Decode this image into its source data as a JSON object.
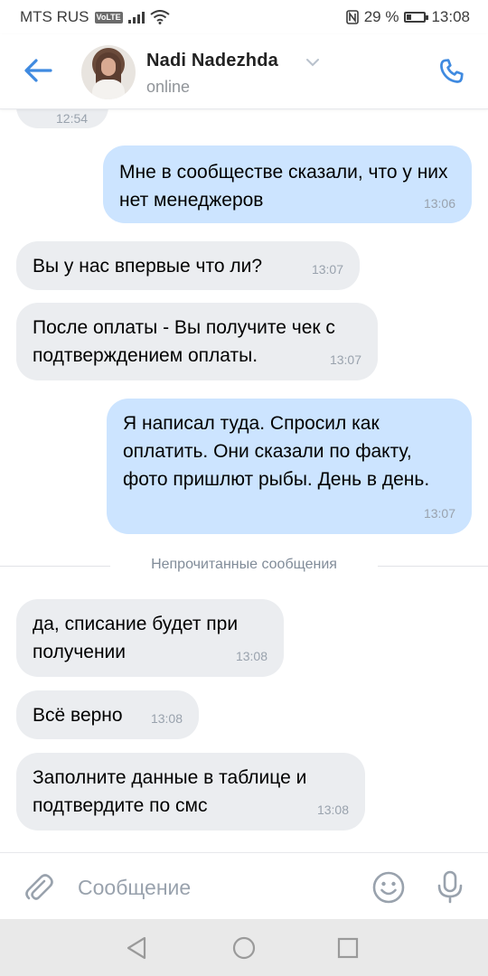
{
  "status_bar": {
    "carrier": "MTS RUS",
    "volte": "VoLTE",
    "battery": "29 %",
    "battery_level": 0.29,
    "time": "13:08"
  },
  "header": {
    "name": "Nadi Nadezhda",
    "status": "online",
    "icons": {
      "back": "back-arrow-icon",
      "call": "phone-icon",
      "dropdown": "chevron-down-icon"
    },
    "accent_color": "#3f8ae0"
  },
  "messages": [
    {
      "dir": "in",
      "text": "",
      "time": "12:54"
    },
    {
      "dir": "out",
      "text": "Мне в сообществе сказали, что у них нет менеджеров",
      "time": "13:06"
    },
    {
      "dir": "in",
      "text": "Вы у нас впервые что ли?",
      "time": "13:07"
    },
    {
      "dir": "in",
      "text": "После оплаты - Вы получите чек с подтверждением оплаты.",
      "time": "13:07"
    },
    {
      "dir": "out",
      "text": "Я написал туда. Спросил как оплатить. Они сказали по факту, фото пришлют рыбы. День в день.",
      "time": "13:07"
    },
    {
      "dir": "in",
      "text": "да, списание будет при получении",
      "time": "13:08"
    },
    {
      "dir": "in",
      "text": "Всё верно",
      "time": "13:08"
    },
    {
      "dir": "in",
      "text": "Заполните данные в таблице и подтвердите по смс",
      "time": "13:08"
    }
  ],
  "unread_divider": "Непрочитанные сообщения",
  "composer": {
    "placeholder": "Сообщение",
    "icons": {
      "attach": "paperclip-icon",
      "emoji": "emoji-icon",
      "mic": "microphone-icon"
    }
  },
  "colors": {
    "incoming_bubble": "#ebedf0",
    "outgoing_bubble": "#cce4ff",
    "time_text": "#99a2ad"
  }
}
